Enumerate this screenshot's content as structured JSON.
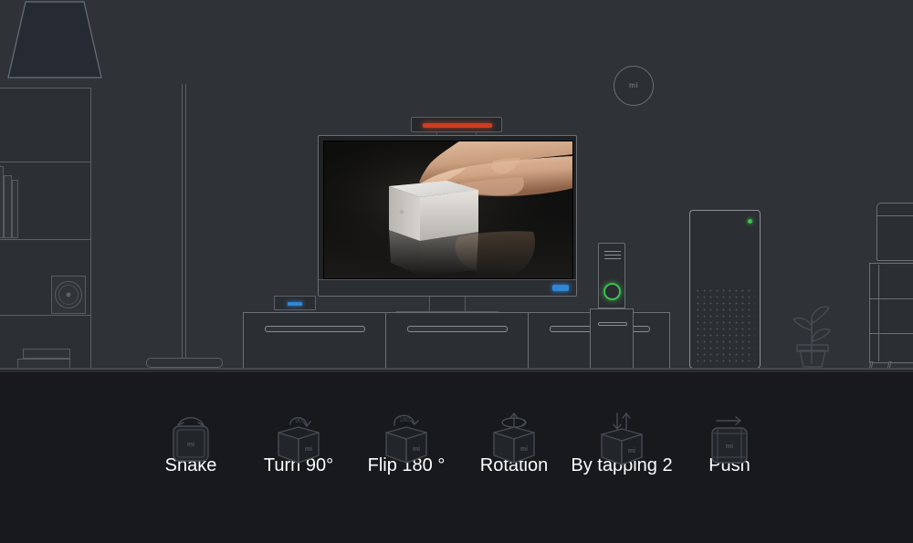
{
  "scene": {
    "name": "living-room-illustration",
    "background_color": "#2f3236",
    "floor_color": "#26292d",
    "objects": {
      "bookshelf": {
        "label": "bookshelf",
        "shelves": 4
      },
      "floor_lamp": {
        "label": "floor-lamp"
      },
      "soundbar": {
        "label": "soundbar-camera",
        "led_color": "#cf3d21"
      },
      "television": {
        "label": "television",
        "led_color": "#2f86d6",
        "screen_content": "hand tapping a white Mi cube controller on a dark reflective table"
      },
      "set_top_box": {
        "label": "set-top-box",
        "led_color": "#2f86d6"
      },
      "tv_stand": {
        "label": "tv-stand",
        "drawers": 3
      },
      "router": {
        "label": "router",
        "ring_color": "#3fbf52"
      },
      "tower_speaker": {
        "label": "tower-speaker",
        "dot_color": "#3fbf52"
      },
      "plant": {
        "label": "potted-plant"
      },
      "cabinet": {
        "label": "side-cabinet"
      },
      "mi_sensor": {
        "label": "mi-circular-sensor",
        "logo": "mi"
      }
    }
  },
  "gestures": {
    "panel_background": "#17191d",
    "label_color": "#fdfdfd",
    "items": [
      {
        "label": "Shake",
        "icon": "cube-shake-icon",
        "art": "flat",
        "badge": ""
      },
      {
        "label": "Turn 90°",
        "icon": "cube-turn-icon",
        "art": "iso",
        "badge": "90"
      },
      {
        "label": "Flip 180 °",
        "icon": "cube-flip-icon",
        "art": "iso",
        "badge": "180"
      },
      {
        "label": "Rotation",
        "icon": "cube-rotation-icon",
        "art": "iso",
        "badge": ""
      },
      {
        "label": "By tapping 2",
        "icon": "cube-tap-icon",
        "art": "iso",
        "badge": ""
      },
      {
        "label": "Push",
        "icon": "cube-push-icon",
        "art": "flat",
        "badge": ""
      }
    ]
  },
  "branding": {
    "mi_logo": "mi"
  }
}
